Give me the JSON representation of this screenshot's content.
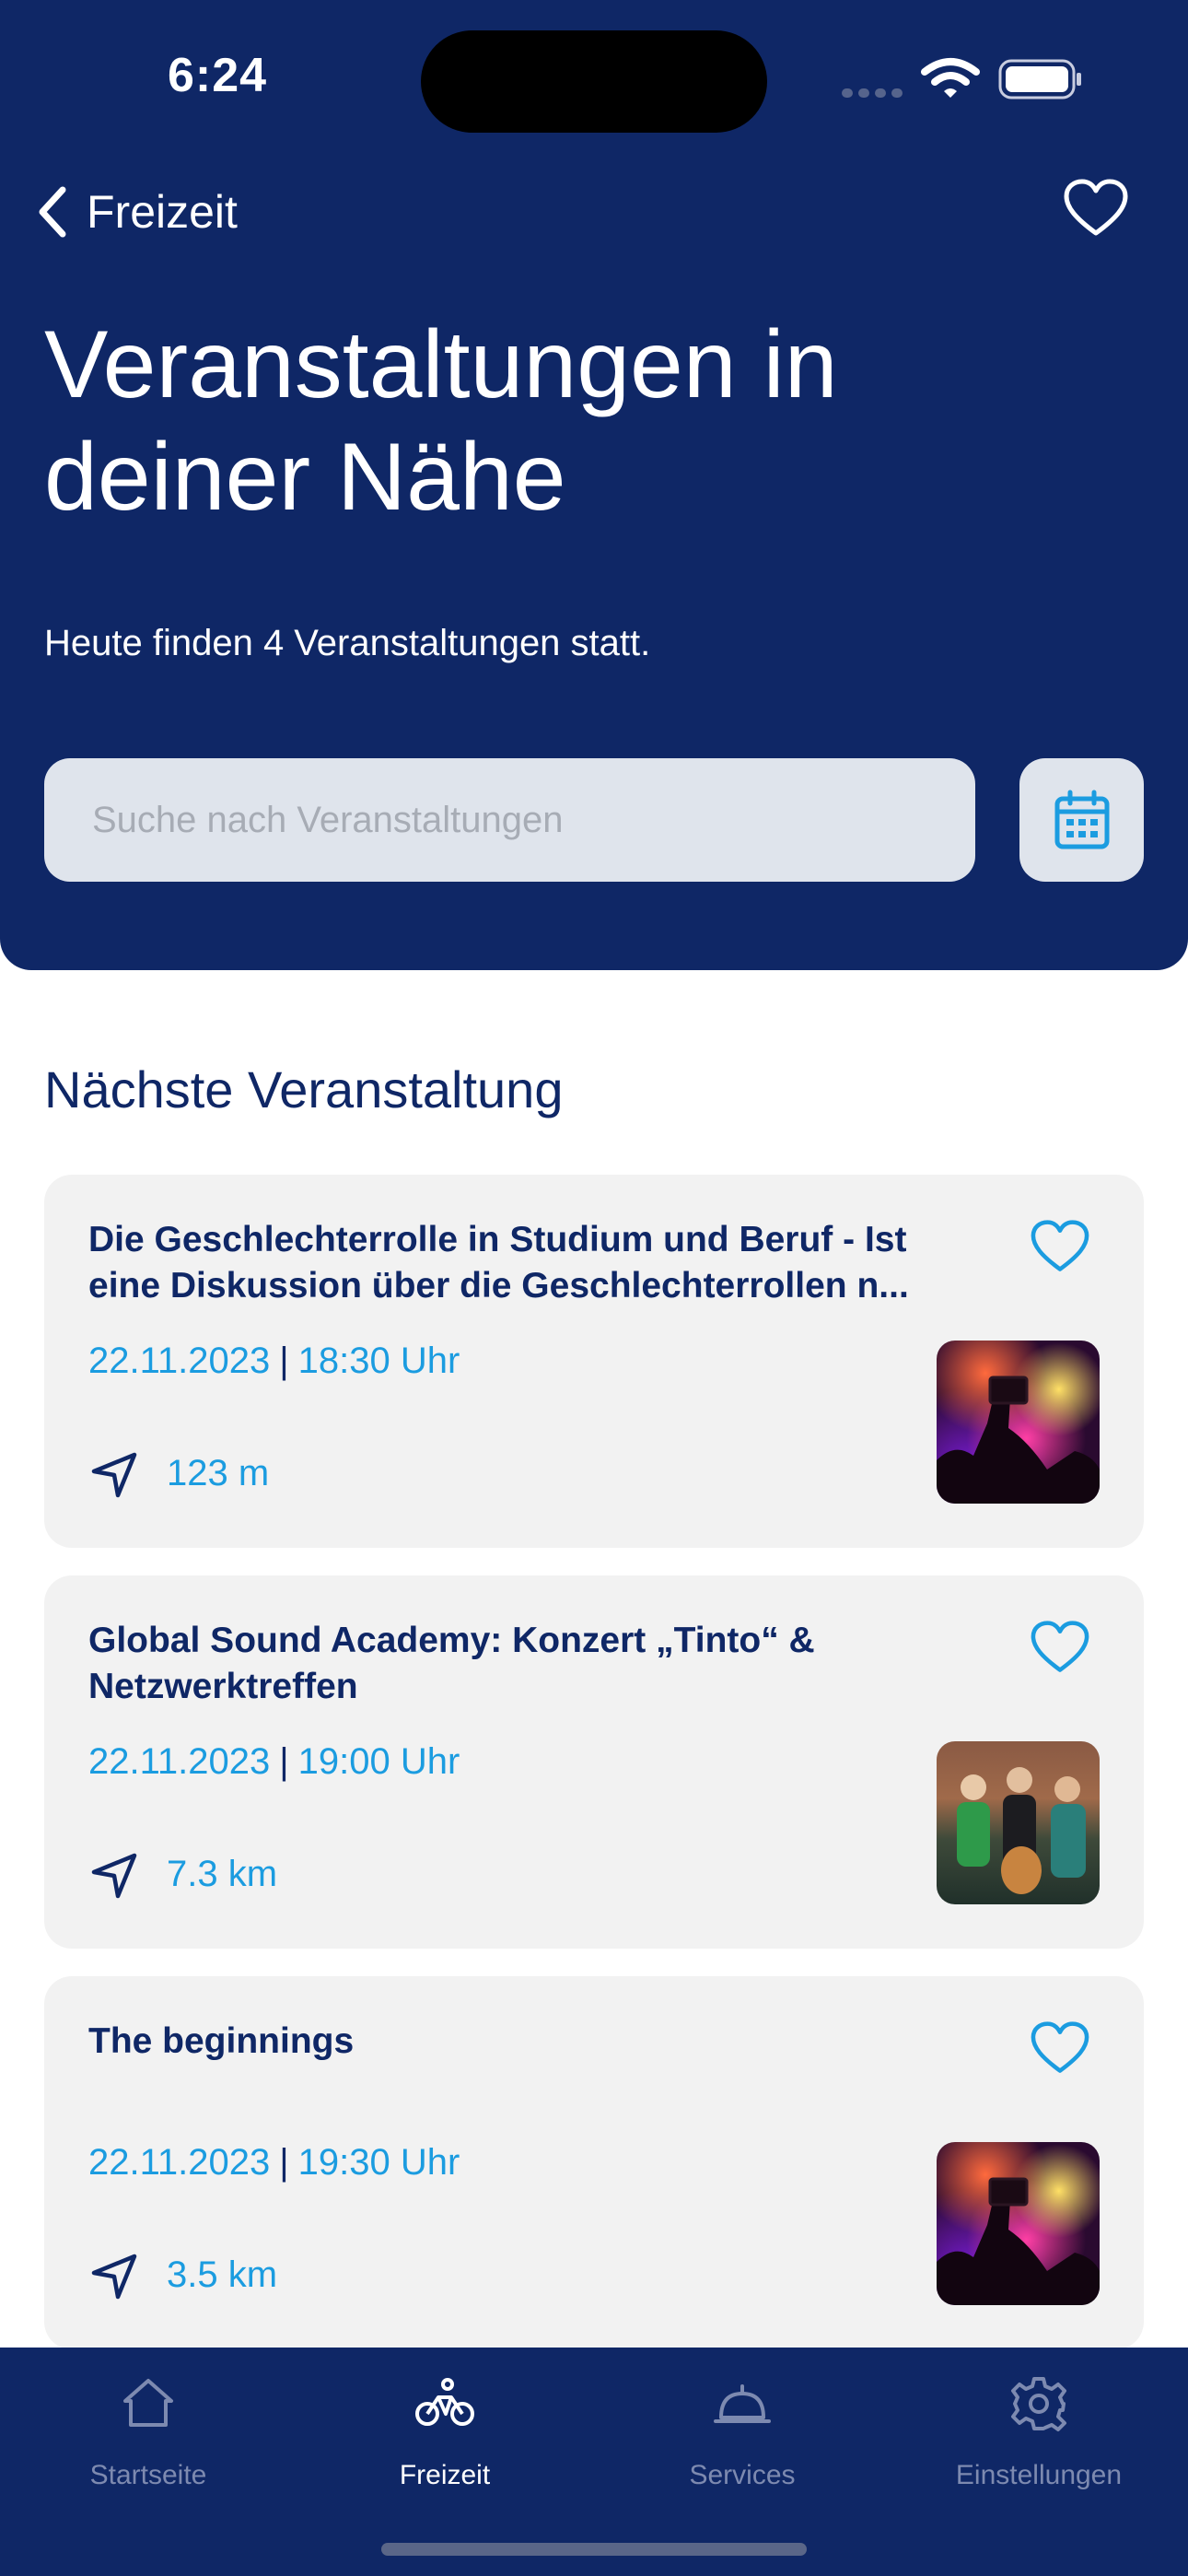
{
  "status_bar": {
    "time": "6:24"
  },
  "nav": {
    "back_label": "Freizeit"
  },
  "header": {
    "title": "Veranstaltungen in deiner Nähe",
    "subtitle": "Heute finden 4 Veranstaltungen statt.",
    "search_placeholder": "Suche nach Veranstaltungen"
  },
  "section": {
    "title": "Nächste Veranstaltung"
  },
  "events": [
    {
      "title": "Die Geschlechterrolle in Studium und Beruf - Ist eine Diskussion über die Geschlechterrollen n...",
      "date": "22.11.2023",
      "time": "18:30 Uhr",
      "distance": "123 m",
      "image": "concert-crowd-photo"
    },
    {
      "title": "Global Sound Academy: Konzert „Tinto“ & Netzwerktreffen",
      "date": "22.11.2023",
      "time": "19:00 Uhr",
      "distance": "7.3 km",
      "image": "band-photo"
    },
    {
      "title": "The beginnings",
      "date": "22.11.2023",
      "time": "19:30 Uhr",
      "distance": "3.5 km",
      "image": "concert-crowd-photo"
    }
  ],
  "tabbar": {
    "items": [
      {
        "label": "Startseite",
        "icon": "home-icon",
        "active": false
      },
      {
        "label": "Freizeit",
        "icon": "bicycle-icon",
        "active": true
      },
      {
        "label": "Services",
        "icon": "service-bell-icon",
        "active": false
      },
      {
        "label": "Einstellungen",
        "icon": "gear-icon",
        "active": false
      }
    ]
  },
  "colors": {
    "header_bg": "#0f2766",
    "accent": "#1b9ce0",
    "card_bg": "#f2f2f2",
    "search_bg": "#dfe4ec"
  }
}
